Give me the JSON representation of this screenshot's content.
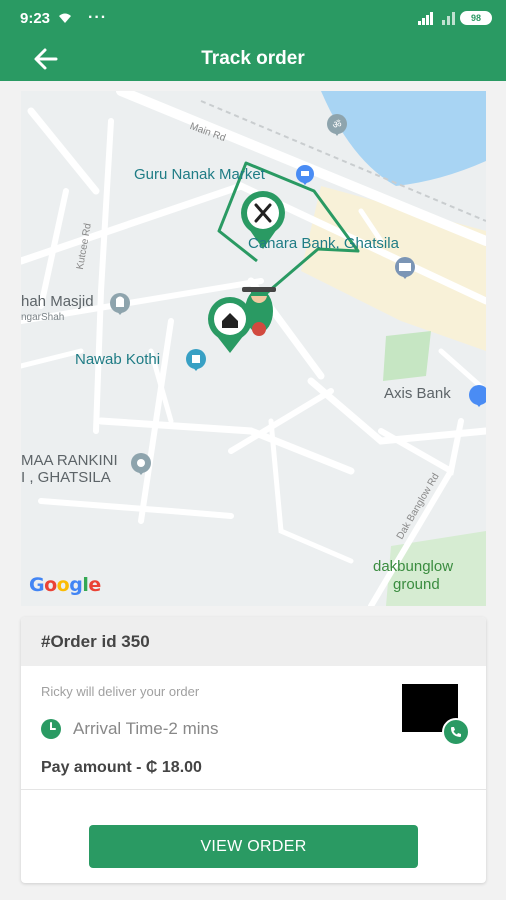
{
  "status_bar": {
    "time": "9:23",
    "dots": "···",
    "battery": "98"
  },
  "header": {
    "title": "Track order",
    "back_icon": "arrow-left-icon"
  },
  "map": {
    "labels": {
      "main_rd": "Main Rd",
      "guru_nanak": "Guru Nanak Market",
      "canara_bank": "Canara Bank, Ghatsila",
      "shah_masjid": "hah Masjid",
      "gar_shah": "ngarShah",
      "nawab_kothi": "Nawab Kothi",
      "axis_bank": "Axis Bank",
      "maa_rankini_1": "MAA RANKINI",
      "maa_rankini_2": "I , GHATSILA",
      "dakbunglow_1": "dakbunglow",
      "dakbunglow_2": "ground",
      "kutcee_rd": "Kutcee Rd",
      "bangla_rd": "Dak Banglow Rd"
    },
    "google": [
      "G",
      "o",
      "o",
      "g",
      "l",
      "e"
    ],
    "restaurant_pin_icon": "fork-knife-icon",
    "home_pin_icon": "home-icon",
    "rider_icon": "scooter-rider-icon",
    "route_color": "#2a9a63"
  },
  "order": {
    "id_label": "#Order id 350",
    "delivery_text": "Ricky will deliver your order",
    "arrival_text": "Arrival Time-2 mins",
    "pay_text": "Pay amount - ₵ 18.00",
    "view_button": "VIEW ORDER"
  },
  "colors": {
    "primary": "#2a9a63",
    "map_bg": "#eceff0",
    "water": "#a8d4f3"
  }
}
